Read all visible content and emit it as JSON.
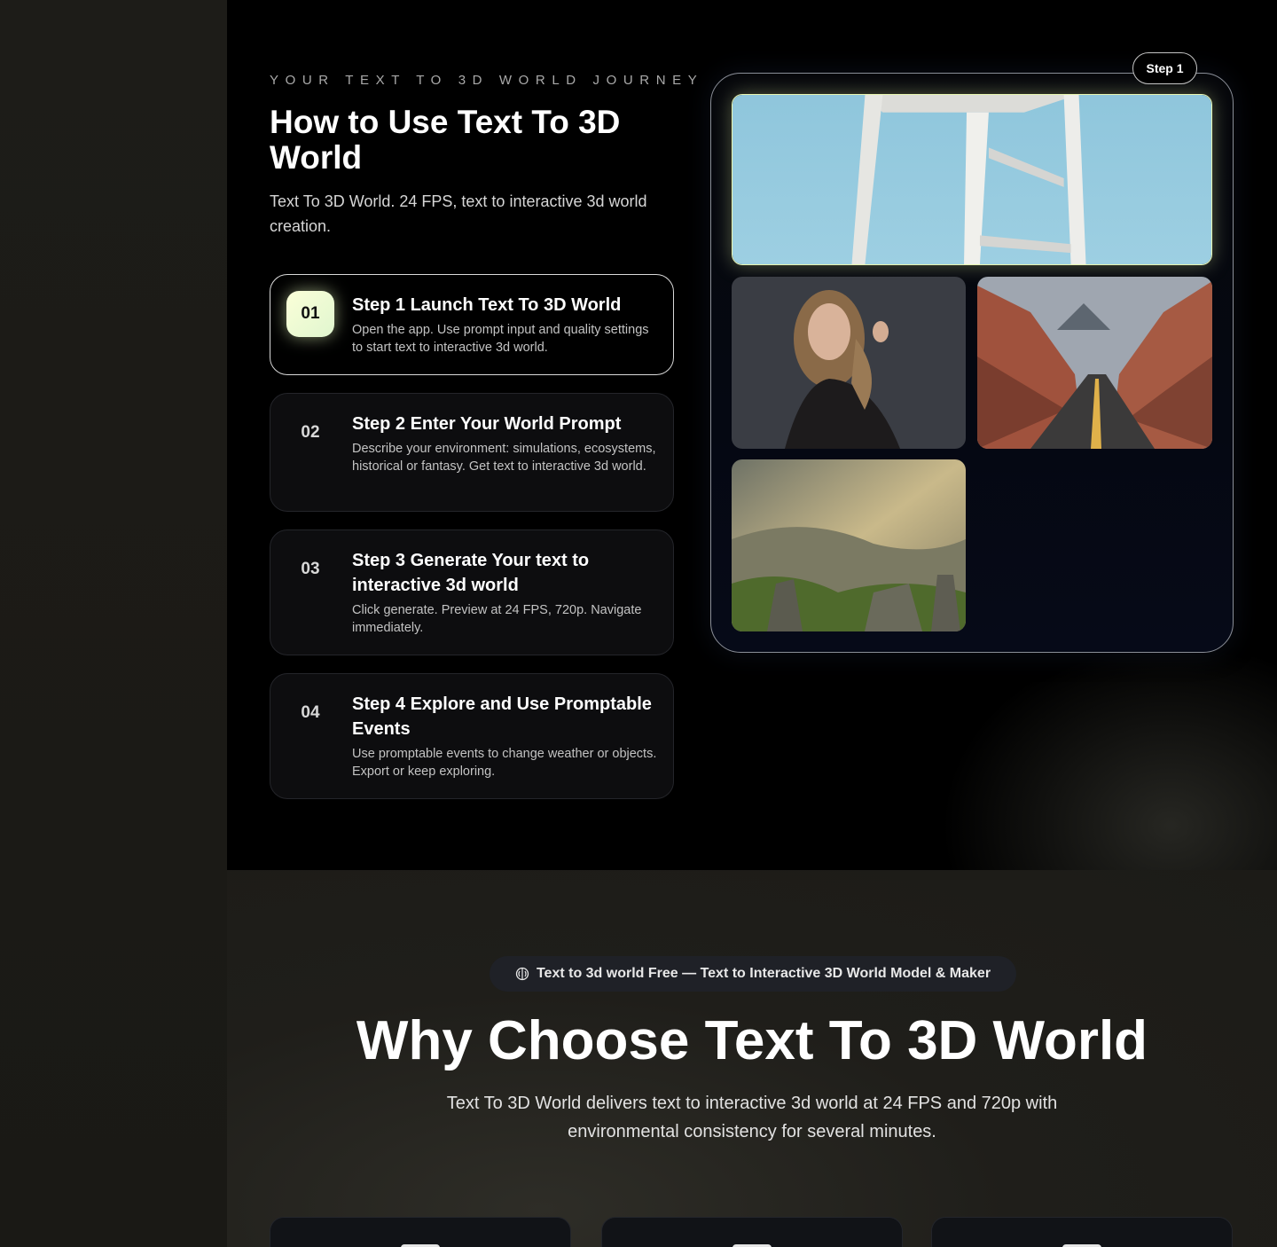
{
  "how_section": {
    "eyebrow": "YOUR TEXT TO 3D WORLD JOURNEY",
    "title": "How to Use Text To 3D World",
    "subtitle": "Text To 3D World. 24 FPS, text to interactive 3d world creation.",
    "steps": [
      {
        "number": "01",
        "title": "Step 1 Launch Text To 3D World",
        "description": "Open the app. Use prompt input and quality settings to start text to interactive 3d world.",
        "active": true
      },
      {
        "number": "02",
        "title": "Step 2 Enter Your World Prompt",
        "description": "Describe your environment: simulations, ecosystems, historical or fantasy. Get text to interactive 3d world.",
        "active": false
      },
      {
        "number": "03",
        "title": "Step 3 Generate Your text to interactive 3d world",
        "description": "Click generate. Preview at 24 FPS, 720p. Navigate immediately.",
        "active": false
      },
      {
        "number": "04",
        "title": "Step 4 Explore and Use Promptable Events",
        "description": "Use promptable events to change weather or objects. Export or keep exploring.",
        "active": false
      }
    ],
    "gallery": {
      "step_pill": "Step 1",
      "images": [
        "white-chair-sky-image",
        "woman-portrait-image",
        "desert-canyon-road-image",
        "mountain-valley-image"
      ]
    }
  },
  "why_section": {
    "badge_icon": "brain-icon",
    "badge": "Text to 3d world Free — Text to Interactive 3D World Model & Maker",
    "title": "Why Choose Text To 3D World",
    "subtitle": "Text To 3D World delivers text to interactive 3d world at 24 FPS and 720p with environmental consistency for several minutes."
  },
  "colors": {
    "accent_glow": "#e8f5b0",
    "page_background": "#000000",
    "card_background": "#0d0d0f"
  }
}
